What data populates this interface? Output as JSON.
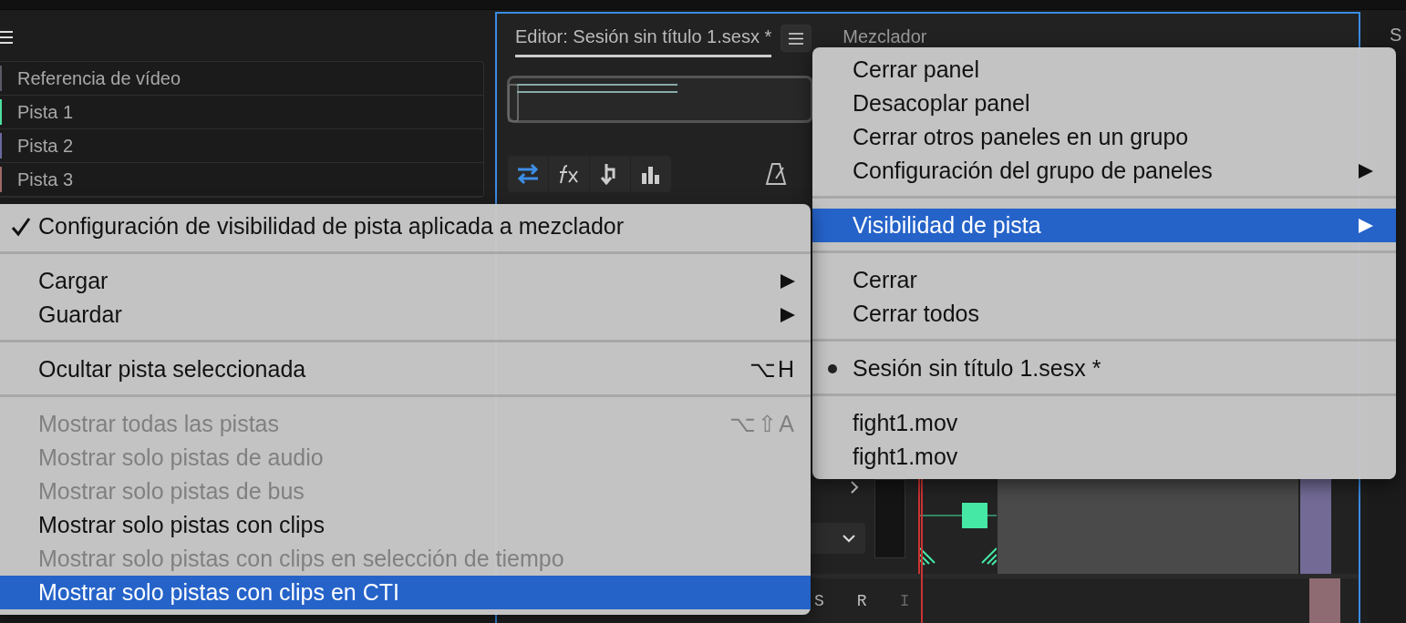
{
  "left_panel": {
    "tracks": [
      {
        "name": "Referencia de vídeo",
        "color": "#5a5a66"
      },
      {
        "name": "Pista 1",
        "color": "#4de0a0"
      },
      {
        "name": "Pista 2",
        "color": "#6a6aa0"
      },
      {
        "name": "Pista 3",
        "color": "#a06868"
      }
    ]
  },
  "editor": {
    "tabs": [
      {
        "label": "Editor: Sesión sin título 1.sesx *",
        "selected": true
      },
      {
        "label": "Mezclador",
        "selected": false
      }
    ],
    "track_controls": [
      "S",
      "R",
      "I"
    ]
  },
  "right_panel": {
    "fragments": [
      "S"
    ]
  },
  "panel_menu": {
    "items": [
      {
        "kind": "item",
        "label": "Cerrar panel",
        "submenu": false,
        "bullet": false,
        "selected": false
      },
      {
        "kind": "item",
        "label": "Desacoplar panel",
        "submenu": false,
        "bullet": false,
        "selected": false
      },
      {
        "kind": "item",
        "label": "Cerrar otros paneles en un grupo",
        "submenu": false,
        "bullet": false,
        "selected": false
      },
      {
        "kind": "item",
        "label": "Configuración del grupo de paneles",
        "submenu": true,
        "bullet": false,
        "selected": false
      },
      {
        "kind": "separator"
      },
      {
        "kind": "item",
        "label": "Visibilidad de pista",
        "submenu": true,
        "bullet": false,
        "selected": true
      },
      {
        "kind": "separator"
      },
      {
        "kind": "item",
        "label": "Cerrar",
        "submenu": false,
        "bullet": false,
        "selected": false
      },
      {
        "kind": "item",
        "label": "Cerrar todos",
        "submenu": false,
        "bullet": false,
        "selected": false
      },
      {
        "kind": "separator"
      },
      {
        "kind": "item",
        "label": "Sesión sin título 1.sesx *",
        "submenu": false,
        "bullet": true,
        "selected": false
      },
      {
        "kind": "separator"
      },
      {
        "kind": "item",
        "label": "fight1.mov",
        "submenu": false,
        "bullet": false,
        "selected": false
      },
      {
        "kind": "item",
        "label": "fight1.mov",
        "submenu": false,
        "bullet": false,
        "selected": false
      }
    ]
  },
  "visibility_menu": {
    "items": [
      {
        "kind": "item",
        "label": "Configuración de visibilidad de pista aplicada a mezclador",
        "checked": true,
        "submenu": false,
        "disabled": false,
        "selected": false
      },
      {
        "kind": "separator"
      },
      {
        "kind": "item",
        "label": "Cargar",
        "checked": false,
        "submenu": true,
        "disabled": false,
        "selected": false
      },
      {
        "kind": "item",
        "label": "Guardar",
        "checked": false,
        "submenu": true,
        "disabled": false,
        "selected": false
      },
      {
        "kind": "separator"
      },
      {
        "kind": "item",
        "label": "Ocultar pista seleccionada",
        "shortcut": "⌥H",
        "checked": false,
        "submenu": false,
        "disabled": false,
        "selected": false
      },
      {
        "kind": "separator"
      },
      {
        "kind": "item",
        "label": "Mostrar todas las pistas",
        "shortcut": "⌥⇧A",
        "checked": false,
        "submenu": false,
        "disabled": true,
        "selected": false
      },
      {
        "kind": "item",
        "label": "Mostrar solo pistas de audio",
        "checked": false,
        "submenu": false,
        "disabled": true,
        "selected": false
      },
      {
        "kind": "item",
        "label": "Mostrar solo pistas de bus",
        "checked": false,
        "submenu": false,
        "disabled": true,
        "selected": false
      },
      {
        "kind": "item",
        "label": "Mostrar solo pistas con clips",
        "checked": false,
        "submenu": false,
        "disabled": false,
        "selected": false
      },
      {
        "kind": "item",
        "label": "Mostrar solo pistas con clips en selección de tiempo",
        "checked": false,
        "submenu": false,
        "disabled": true,
        "selected": false
      },
      {
        "kind": "item",
        "label": "Mostrar solo pistas con clips en CTI",
        "checked": false,
        "submenu": false,
        "disabled": false,
        "selected": true
      }
    ]
  }
}
